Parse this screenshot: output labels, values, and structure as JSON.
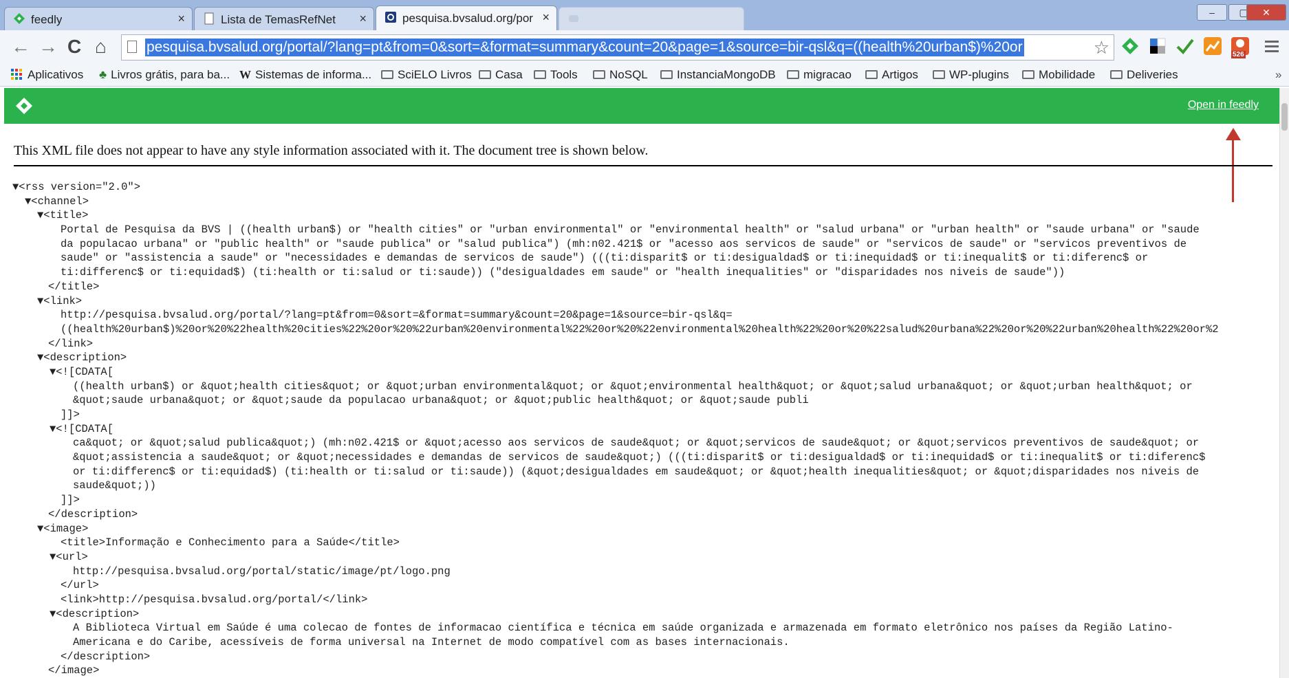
{
  "tabs": [
    {
      "label": "feedly",
      "close": "×",
      "icon": "feedly-icon"
    },
    {
      "label": "Lista de TemasRefNet",
      "close": "×",
      "icon": "page-icon"
    },
    {
      "label": "pesquisa.bvsalud.org/port",
      "close": "×",
      "icon": "bvs-icon"
    },
    {
      "label": "",
      "close": "",
      "icon": "blurred-tab-icon"
    }
  ],
  "window_controls": {
    "minimize": "–",
    "maximize": "▢",
    "close": "✕"
  },
  "toolbar": {
    "back": "←",
    "forward": "→",
    "reload": "C",
    "home": "⌂",
    "url": "pesquisa.bvsalud.org/portal/?lang=pt&from=0&sort=&format=summary&count=20&page=1&source=bir-qsl&q=((health%20urban$)%20or",
    "star": "☆",
    "ext_badge": "526"
  },
  "bookmarks": {
    "apps": "Aplicativos",
    "items": [
      "Livros grátis, para ba...",
      "Sistemas de informa...",
      "SciELO Livros",
      "Casa",
      "Tools",
      "NoSQL",
      "InstanciaMongoDB",
      "migracao",
      "Artigos",
      "WP-plugins",
      "Mobilidade",
      "Deliveries"
    ],
    "more": "»"
  },
  "feedly_bar": {
    "open_link": "Open in feedly"
  },
  "notice": "This XML file does not appear to have any style information associated with it. The document tree is shown below.",
  "xml": {
    "l01": "▼<rss version=\"2.0\">",
    "l02": "▼<channel>",
    "l03": "▼<title>",
    "l04": "Portal de Pesquisa da BVS | ((health urban$) or \"health cities\" or \"urban environmental\" or \"environmental health\" or \"salud urbana\" or \"urban health\" or \"saude urbana\" or \"saude",
    "l05": "da populacao urbana\" or \"public health\" or \"saude publica\" or \"salud publica\") (mh:n02.421$ or \"acesso aos servicos de saude\" or \"servicos de saude\" or \"servicos preventivos de",
    "l06": "saude\" or \"assistencia a saude\" or \"necessidades e demandas de servicos de saude\") (((ti:disparit$ or ti:desigualdad$ or ti:inequidad$ or ti:inequalit$ or ti:diferenc$ or",
    "l07": "ti:differenc$ or ti:equidad$) (ti:health or ti:salud or ti:saude)) (\"desigualdades em saude\" or \"health inequalities\" or \"disparidades nos niveis de saude\"))",
    "l08": "</title>",
    "l09": "▼<link>",
    "l10": "http://pesquisa.bvsalud.org/portal/?lang=pt&from=0&sort=&format=summary&count=20&page=1&source=bir-qsl&q=",
    "l11": "((health%20urban$)%20or%20%22health%20cities%22%20or%20%22urban%20environmental%22%20or%20%22environmental%20health%22%20or%20%22salud%20urbana%22%20or%20%22urban%20health%22%20or%2",
    "l12": "</link>",
    "l13": "▼<description>",
    "l14": "▼<![CDATA[",
    "l15": "((health urban$) or &quot;health cities&quot; or &quot;urban environmental&quot; or &quot;environmental health&quot; or &quot;salud urbana&quot; or &quot;urban health&quot; or",
    "l16": "&quot;saude urbana&quot; or &quot;saude da populacao urbana&quot; or &quot;public health&quot; or &quot;saude publi",
    "l17": "]]>",
    "l18": "▼<![CDATA[",
    "l19": "ca&quot; or &quot;salud publica&quot;) (mh:n02.421$ or &quot;acesso aos servicos de saude&quot; or &quot;servicos de saude&quot; or &quot;servicos preventivos de saude&quot; or",
    "l20": "&quot;assistencia a saude&quot; or &quot;necessidades e demandas de servicos de saude&quot;) (((ti:disparit$ or ti:desigualdad$ or ti:inequidad$ or ti:inequalit$ or ti:diferenc$",
    "l21": "or ti:differenc$ or ti:equidad$) (ti:health or ti:salud or ti:saude)) (&quot;desigualdades em saude&quot; or &quot;health inequalities&quot; or &quot;disparidades nos niveis de",
    "l22": "saude&quot;))",
    "l23": "]]>",
    "l24": "</description>",
    "l25": "▼<image>",
    "l26": "<title>Informação e Conhecimento para a Saúde</title>",
    "l27": "▼<url>",
    "l28": "http://pesquisa.bvsalud.org/portal/static/image/pt/logo.png",
    "l29": "</url>",
    "l30": "<link>http://pesquisa.bvsalud.org/portal/</link>",
    "l31": "▼<description>",
    "l32": "A Biblioteca Virtual em Saúde é uma colecao de fontes de informacao científica e técnica em saúde organizada e armazenada em formato eletrônico nos países da Região Latino-",
    "l33": "Americana e do Caribe, acessíveis de forma universal na Internet de modo compatível com as bases internacionais.",
    "l34": "</description>",
    "l35": "</image>"
  },
  "colors": {
    "feedly_green": "#2bb24c",
    "annotation_arrow": "#c0392b",
    "url_highlight": "#3a78e0"
  }
}
